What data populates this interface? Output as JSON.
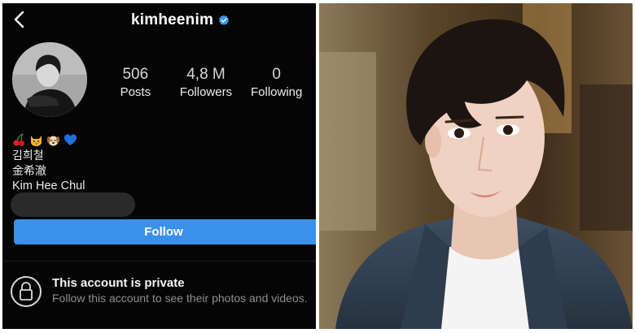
{
  "profile": {
    "username": "kimheenim",
    "verified_icon": "verified-badge-icon",
    "stats": [
      {
        "value": "506",
        "label": "Posts"
      },
      {
        "value": "4,8 M",
        "label": "Followers"
      },
      {
        "value": "0",
        "label": "Following"
      }
    ],
    "bio": {
      "emojis": [
        "cherries-emoji",
        "cat-emoji",
        "dog-emoji",
        "blue-heart-emoji"
      ],
      "lines": [
        "김희철",
        "金希澈",
        "Kim Hee Chul"
      ]
    },
    "follow_label": "Follow",
    "private": {
      "title": "This account is private",
      "subtitle": "Follow this account to see their photos and videos."
    }
  },
  "colors": {
    "background": "#050505",
    "follow_button": "#3b91ea",
    "verified": "#3897f0",
    "muted_text": "#8e8e8e"
  }
}
